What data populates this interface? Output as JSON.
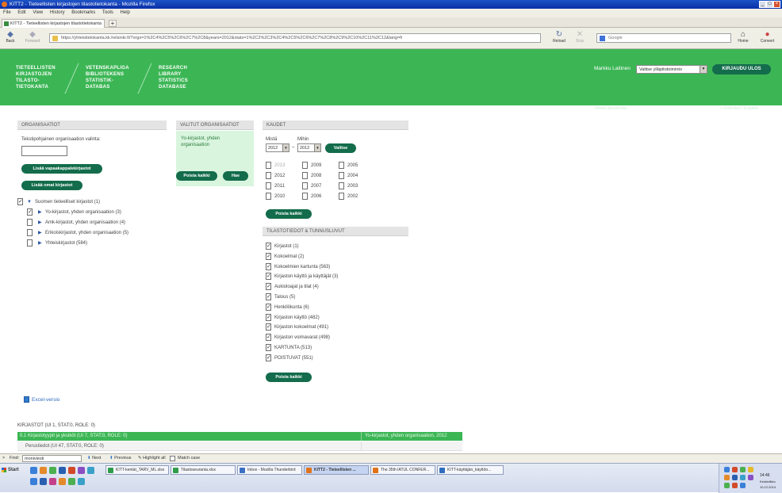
{
  "window": {
    "title": "KITT2 - Tieteellisten kirjastojen tilastotietokanta - Mozilla Firefox"
  },
  "menu": [
    "File",
    "Edit",
    "View",
    "History",
    "Bookmarks",
    "Tools",
    "Help"
  ],
  "tab": {
    "title": "KITT2 - Tieteellisten kirjastojen tilastotietokanta"
  },
  "nav": {
    "back": "Back",
    "forward": "Forward",
    "reload": "Reload",
    "stop": "Stop",
    "home": "Home",
    "convert": "Convert",
    "url": "https://yhteistietokanta.kk.helsinki.fi/?orgs=1%2C4%2C5%2C6%2C7%2C8&years=2012&stats=1%2C2%2C3%2C4%2C5%2C6%2C7%2C8%2C9%2C10%2C11%2C12&lang=fi",
    "search_placeholder": "Google"
  },
  "header": {
    "brand_fi": "TIETEELLISTEN\nKIRJASTOJEN\nTILASTO-\nTIETOKANTA",
    "brand_sv": "VETENSKAPLIGA\nBIBLIOTEKENS\nSTATISTIK-\nDATABAS",
    "brand_en": "RESEARCH\nLIBRARY\nSTATISTICS\nDATABASE",
    "user_name": "Markku Laitinen",
    "role_value": "Valitse ylläpitotoiminto",
    "logout_label": "KIRJAUDU ULOS",
    "feedback_link": "Tietoa sivustosta",
    "lang_current": "Suomi",
    "lang_sv": "Svenska",
    "lang_en": "English"
  },
  "organisations": {
    "heading": "ORGANISAATIOT",
    "text_filter_label": "Tekstipohjainen organisaation valinta:",
    "add_deposit_button": "Lisää vapaakappalekirjastot",
    "add_own_button": "Lisää omat kirjastot",
    "tree_root": "Suomen tieteelliset kirjastot (1)",
    "tree_items": [
      "Yo-kirjastot, yhden organisaation (3)",
      "Amk-kirjastot, yhden organisaation (4)",
      "Erikoiskirjastot, yhden organisaation (5)",
      "Yhteiskirjastot (584)"
    ]
  },
  "selected_orgs": {
    "heading": "VALITUT ORGANISAATIOT",
    "item": "Yo-kirjastot, yhden organisaation",
    "remove_all_button": "Poista kaikki",
    "search_button": "Hae"
  },
  "periods": {
    "heading": "KAUDET",
    "from_label": "Mistä",
    "to_label": "Mihin",
    "from_value": "2012",
    "to_value": "2012",
    "select_button": "Valitse",
    "years_col1": [
      "2013",
      "2012",
      "2011",
      "2010"
    ],
    "years_col2": [
      "2009",
      "2008",
      "2007",
      "2006"
    ],
    "years_col3": [
      "2005",
      "2004",
      "2003",
      "2002"
    ],
    "remove_all_button": "Poista kaikki"
  },
  "stats": {
    "heading": "TILASTOTIEDOT & TUNNUSLUVUT",
    "items": [
      "Kirjastot (1)",
      "Kokoelmat (2)",
      "Kokoelmien kartunta (563)",
      "Kirjaston käyttö ja käyttäjät (3)",
      "Aukioloajat ja tilat (4)",
      "Talous (5)",
      "Henkilökunta (6)",
      "Kirjaston käyttö (482)",
      "Kirjaston kokoelmat (491)",
      "Kirjaston voimavarat (498)",
      "KARTUNTA (513)",
      "POISTUVAT (551)"
    ],
    "remove_all_button": "Poista kaikki"
  },
  "excel_link": "Excel-versio",
  "results": {
    "caption": "KIRJASTOT (UI 1, STAT:0, ROLE: 0)",
    "row1_left": "0.1 Kirjastotyypit ja yksiköt (UI 7, STAT:0, ROLE: 0)",
    "row1_right": "Yo-kirjastot, yhden organisaation, 2012",
    "row2_left": "Perustiedot (UI 47, STAT:0, ROLE: 0)"
  },
  "findbar": {
    "label": "Find:",
    "value": "moniviesti",
    "next": "Next",
    "previous": "Previous",
    "highlight": "Highlight all",
    "matchcase": "Match case"
  },
  "taskbar": {
    "start": "Start",
    "buttons": [
      "KITT-kentät_TARV_ML.xlsx",
      "Tilastoseuranta.xlsx",
      "Inbox - Mozilla Thunderbird",
      "KITT2 - Tieteellisten ...",
      "The 35th IATUL CONFER...",
      "KITT-käyttäjän_käyttöo..."
    ],
    "time": "14:46",
    "day": "Keskiviikko",
    "date": "10.12.2014"
  },
  "colors": {
    "accent_green": "#3cb655",
    "button_green": "#136c4c",
    "titlebar_blue": "#0a2fa8"
  }
}
